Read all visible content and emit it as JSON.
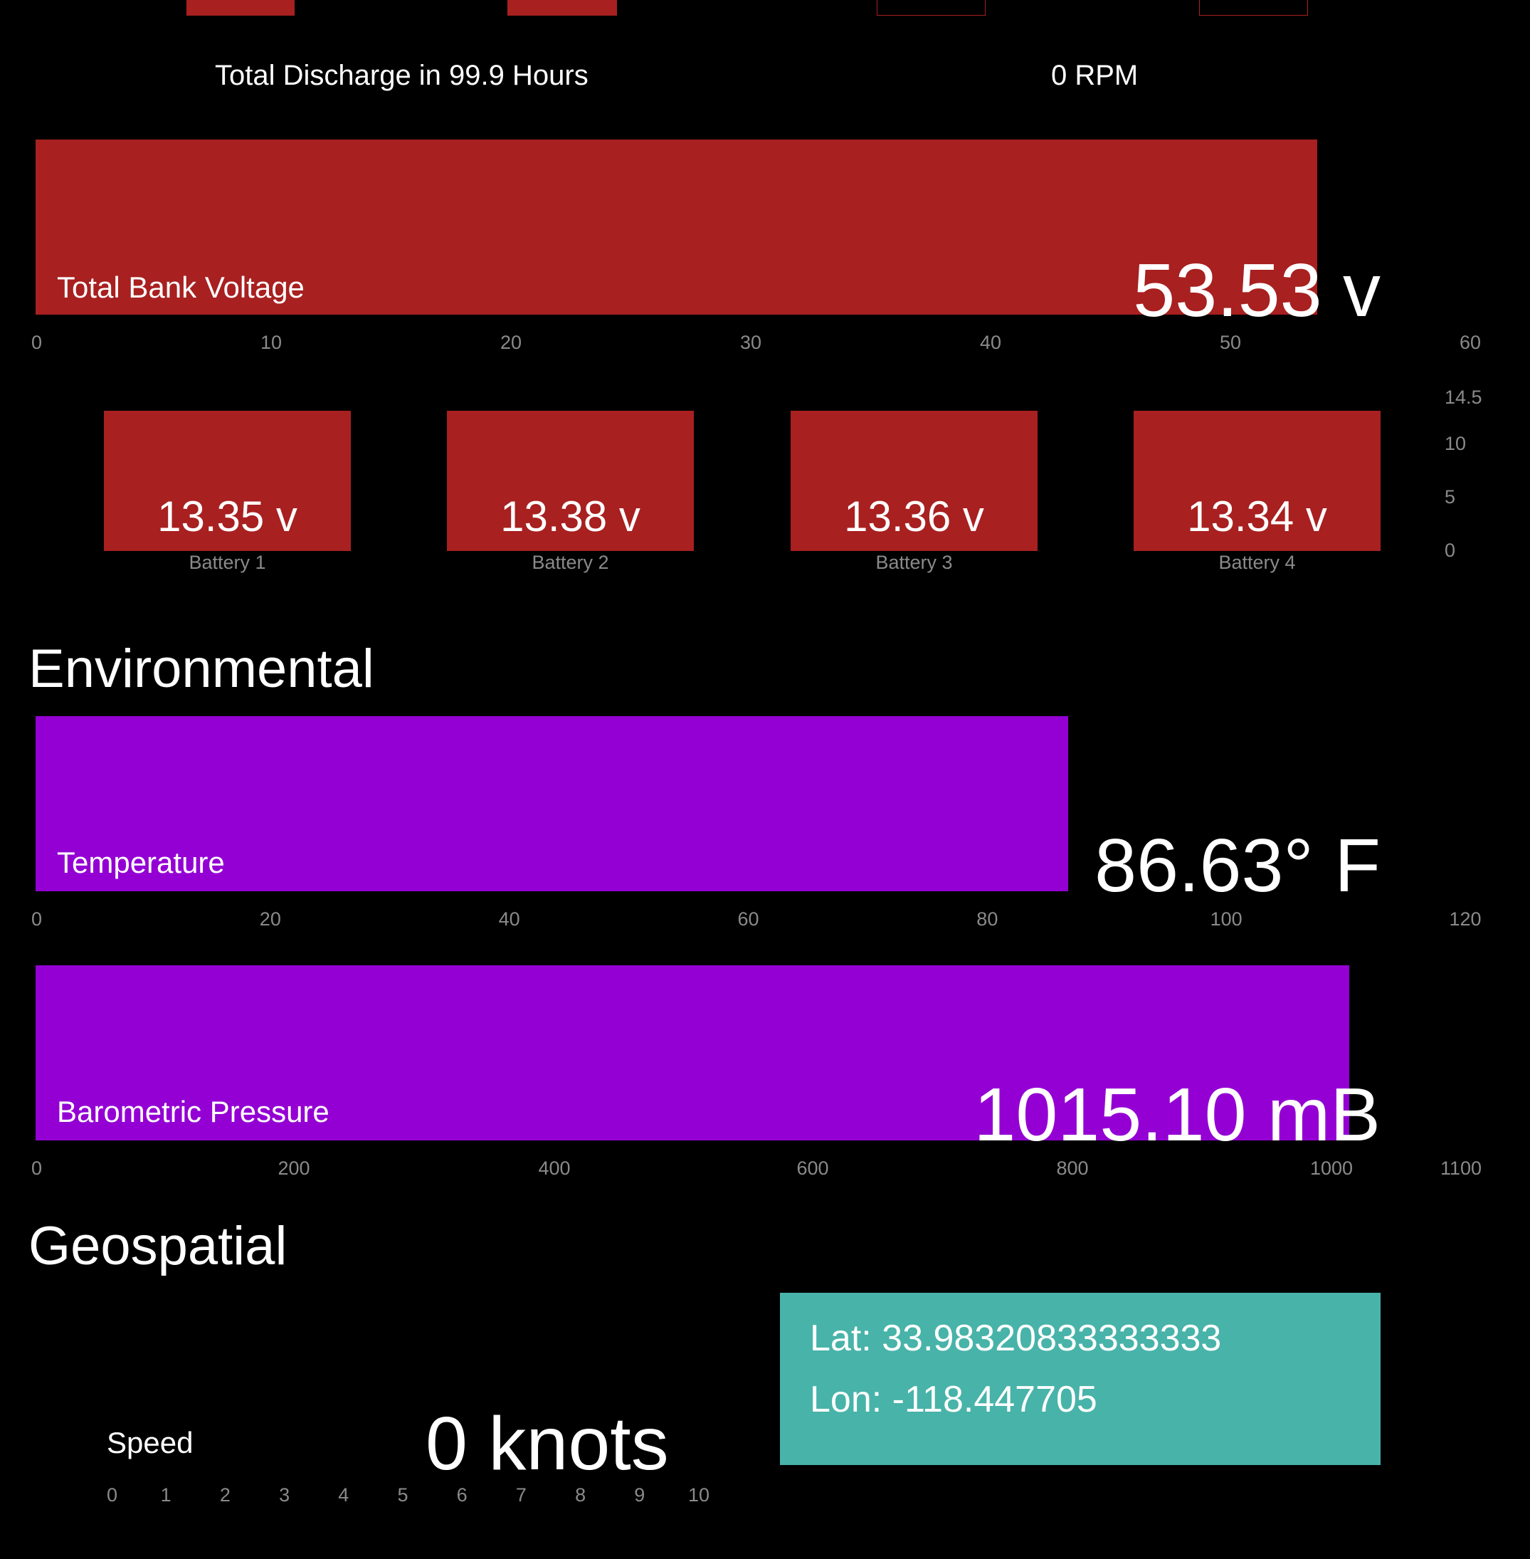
{
  "top_row": {
    "discharge_caption": "Total Discharge in 99.9 Hours",
    "rpm_caption": "0 RPM"
  },
  "total_voltage": {
    "label": "Total Bank Voltage",
    "value": 53.53,
    "value_text": "53.53 v",
    "range": [
      0,
      60
    ],
    "ticks": [
      "0",
      "10",
      "20",
      "30",
      "40",
      "50",
      "60"
    ]
  },
  "batteries": {
    "scale_ticks": [
      "14.5",
      "10",
      "5",
      "0"
    ],
    "items": [
      {
        "name": "Battery 1",
        "value_text": "13.35 v",
        "value": 13.35
      },
      {
        "name": "Battery 2",
        "value_text": "13.38 v",
        "value": 13.38
      },
      {
        "name": "Battery 3",
        "value_text": "13.36 v",
        "value": 13.36
      },
      {
        "name": "Battery 4",
        "value_text": "13.34 v",
        "value": 13.34
      }
    ]
  },
  "environmental": {
    "title": "Environmental",
    "temperature": {
      "label": "Temperature",
      "value": 86.63,
      "value_text": "86.63° F",
      "range": [
        0,
        120
      ],
      "ticks": [
        "0",
        "20",
        "40",
        "60",
        "80",
        "100",
        "120"
      ]
    },
    "pressure": {
      "label": "Barometric Pressure",
      "value": 1015.1,
      "value_text": "1015.10 mB",
      "range": [
        0,
        1100
      ],
      "ticks": [
        "0",
        "200",
        "400",
        "600",
        "800",
        "1000",
        "1100"
      ]
    }
  },
  "geospatial": {
    "title": "Geospatial",
    "speed": {
      "label": "Speed",
      "value": 0,
      "value_text": "0 knots",
      "range": [
        0,
        10
      ],
      "ticks": [
        "0",
        "1",
        "2",
        "3",
        "4",
        "5",
        "6",
        "7",
        "8",
        "9",
        "10"
      ]
    },
    "lat_text": "Lat: 33.98320833333333",
    "lon_text": "Lon: -118.447705"
  },
  "colors": {
    "background": "#000000",
    "electrical": "#a82020",
    "environmental": "#9400d3",
    "geospatial": "#48b3a9",
    "tick_text": "#8a8a8a"
  }
}
